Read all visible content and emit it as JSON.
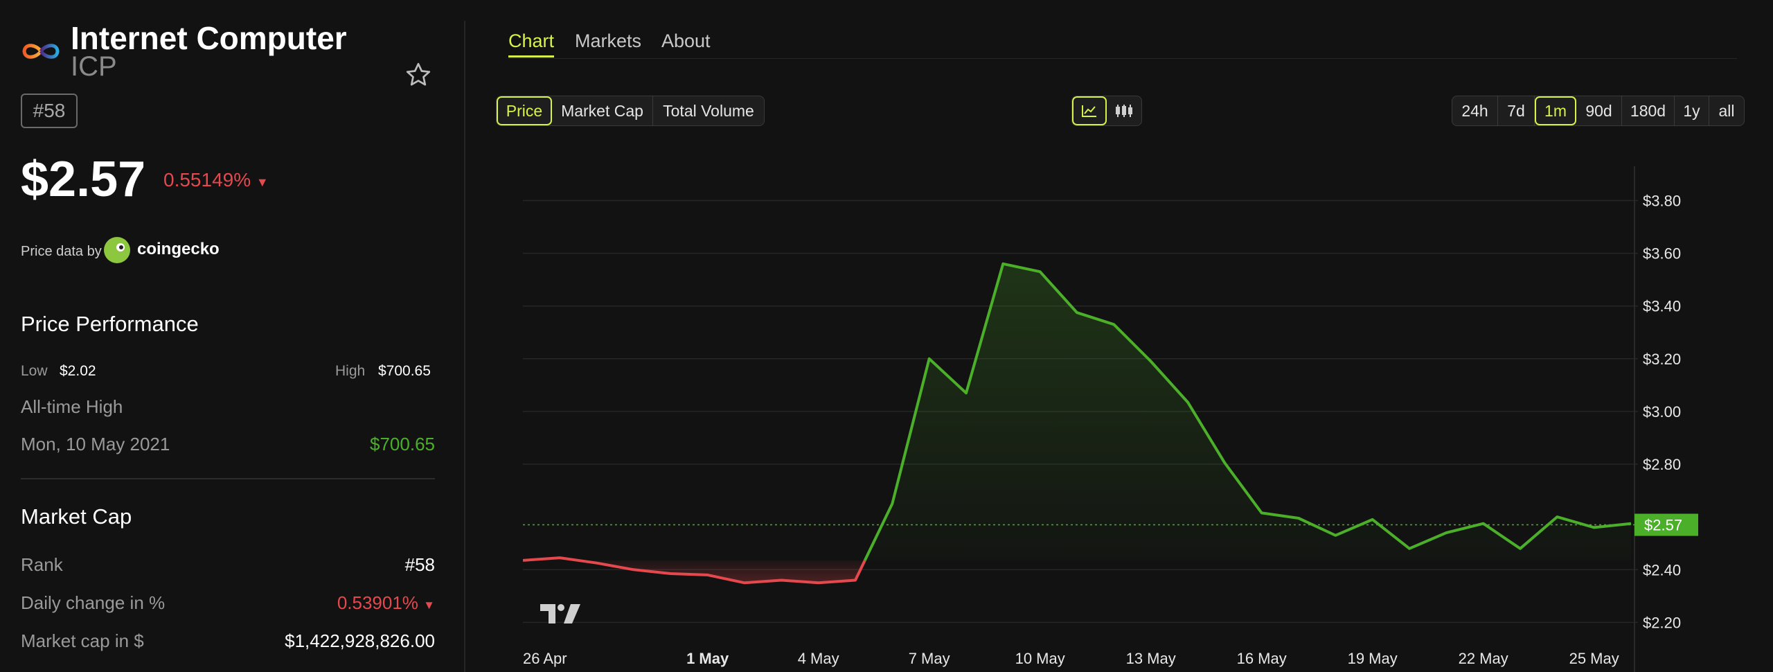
{
  "coin": {
    "name": "Internet Computer",
    "symbol": "ICP",
    "rank_badge": "#58",
    "price": "$2.57",
    "change_24h": "0.55149%",
    "change_direction": "down",
    "price_data_by": "Price data by",
    "data_source": "coingecko"
  },
  "performance": {
    "title": "Price Performance",
    "low_label": "Low",
    "low_value": "$2.02",
    "high_label": "High",
    "high_value": "$700.65",
    "ath_label": "All-time High",
    "ath_date": "Mon, 10 May 2021",
    "ath_value": "$700.65"
  },
  "market_cap": {
    "title": "Market Cap",
    "rank_label": "Rank",
    "rank_value": "#58",
    "daily_change_label": "Daily change in %",
    "daily_change_value": "0.53901%",
    "cap_label": "Market cap in $",
    "cap_value": "$1,422,928,826.00"
  },
  "tabs": [
    {
      "label": "Chart",
      "active": true
    },
    {
      "label": "Markets",
      "active": false
    },
    {
      "label": "About",
      "active": false
    }
  ],
  "metric_buttons": [
    {
      "label": "Price",
      "active": true
    },
    {
      "label": "Market Cap",
      "active": false
    },
    {
      "label": "Total Volume",
      "active": false
    }
  ],
  "chart_type_buttons": [
    {
      "icon": "line-chart-icon",
      "active": true
    },
    {
      "icon": "candlestick-icon",
      "active": false
    }
  ],
  "range_buttons": [
    {
      "label": "24h",
      "active": false
    },
    {
      "label": "7d",
      "active": false
    },
    {
      "label": "1m",
      "active": true
    },
    {
      "label": "90d",
      "active": false
    },
    {
      "label": "180d",
      "active": false
    },
    {
      "label": "1y",
      "active": false
    },
    {
      "label": "all",
      "active": false
    }
  ],
  "colors": {
    "accent": "#d8f24a",
    "up": "#4caf2a",
    "down": "#e5484d",
    "background": "#121212"
  },
  "chart_data": {
    "type": "line",
    "ylim": [
      2.13,
      3.93
    ],
    "y_ticks": [
      2.2,
      2.4,
      2.8,
      3.0,
      3.2,
      3.4,
      3.6,
      3.8
    ],
    "y_tick_labels": [
      "$2.20",
      "$2.40",
      "$2.80",
      "$3.00",
      "$3.20",
      "$3.40",
      "$3.60",
      "$3.80"
    ],
    "x_ticks": [
      {
        "index": 0,
        "label": "26 Apr",
        "bold": false
      },
      {
        "index": 5,
        "label": "1 May",
        "bold": true
      },
      {
        "index": 8,
        "label": "4 May",
        "bold": false
      },
      {
        "index": 11,
        "label": "7 May",
        "bold": false
      },
      {
        "index": 14,
        "label": "10 May",
        "bold": false
      },
      {
        "index": 17,
        "label": "13 May",
        "bold": false
      },
      {
        "index": 20,
        "label": "16 May",
        "bold": false
      },
      {
        "index": 23,
        "label": "19 May",
        "bold": false
      },
      {
        "index": 26,
        "label": "22 May",
        "bold": false
      },
      {
        "index": 29,
        "label": "25 May",
        "bold": false
      }
    ],
    "series": [
      {
        "values": [
          2.435,
          2.445,
          2.425,
          2.4,
          2.385,
          2.38,
          2.35,
          2.36,
          2.35,
          2.36,
          2.65,
          3.2,
          3.07,
          3.56,
          3.53,
          3.375,
          3.33,
          3.19,
          3.035,
          2.805,
          2.615,
          2.595,
          2.53,
          2.59,
          2.48,
          2.54,
          2.575,
          2.48,
          2.6,
          2.56,
          2.575
        ]
      }
    ],
    "current_price": 2.57,
    "current_price_label": "$2.57",
    "baseline": 2.435,
    "grid": true
  }
}
